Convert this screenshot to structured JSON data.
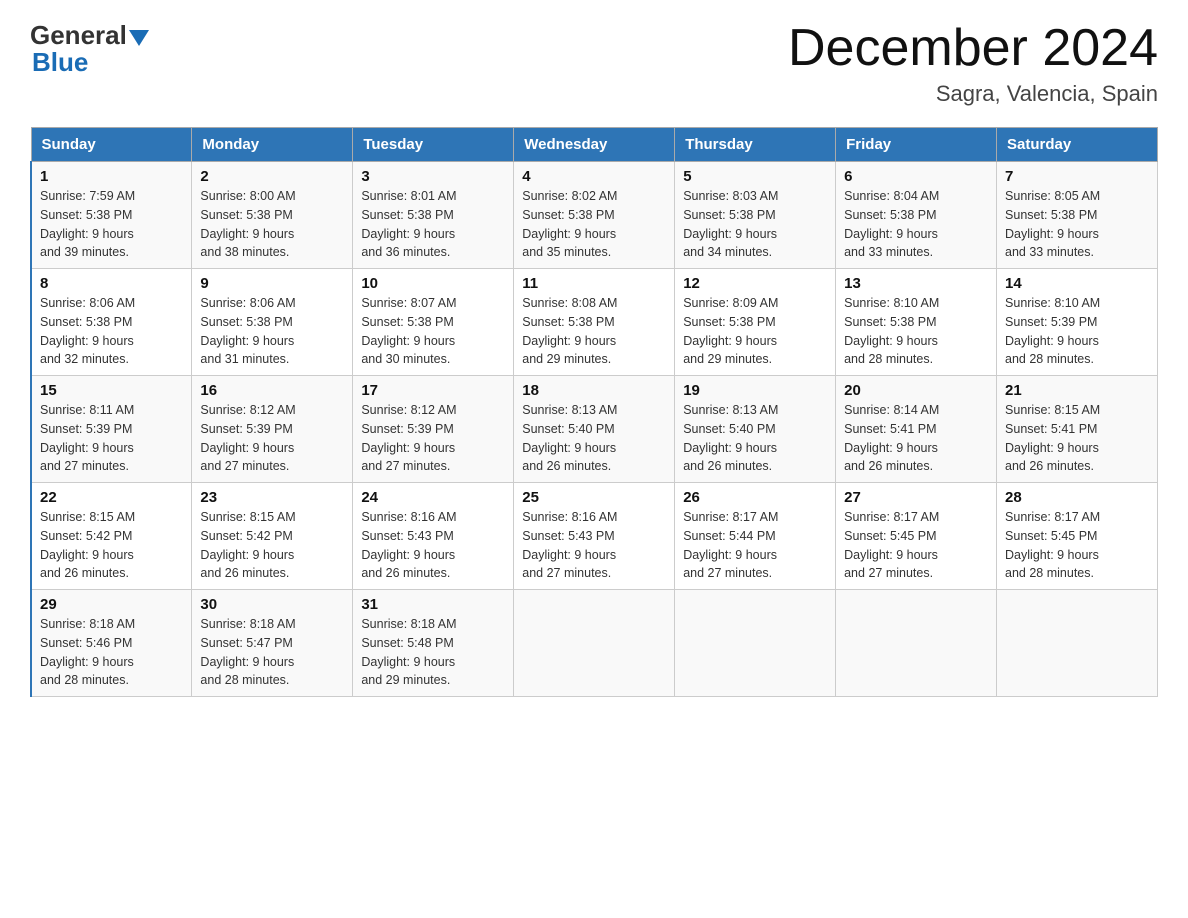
{
  "header": {
    "logo_general": "General",
    "logo_blue": "Blue",
    "title": "December 2024",
    "subtitle": "Sagra, Valencia, Spain"
  },
  "days_of_week": [
    "Sunday",
    "Monday",
    "Tuesday",
    "Wednesday",
    "Thursday",
    "Friday",
    "Saturday"
  ],
  "weeks": [
    [
      {
        "day": "1",
        "sunrise": "7:59 AM",
        "sunset": "5:38 PM",
        "daylight": "9 hours and 39 minutes."
      },
      {
        "day": "2",
        "sunrise": "8:00 AM",
        "sunset": "5:38 PM",
        "daylight": "9 hours and 38 minutes."
      },
      {
        "day": "3",
        "sunrise": "8:01 AM",
        "sunset": "5:38 PM",
        "daylight": "9 hours and 36 minutes."
      },
      {
        "day": "4",
        "sunrise": "8:02 AM",
        "sunset": "5:38 PM",
        "daylight": "9 hours and 35 minutes."
      },
      {
        "day": "5",
        "sunrise": "8:03 AM",
        "sunset": "5:38 PM",
        "daylight": "9 hours and 34 minutes."
      },
      {
        "day": "6",
        "sunrise": "8:04 AM",
        "sunset": "5:38 PM",
        "daylight": "9 hours and 33 minutes."
      },
      {
        "day": "7",
        "sunrise": "8:05 AM",
        "sunset": "5:38 PM",
        "daylight": "9 hours and 33 minutes."
      }
    ],
    [
      {
        "day": "8",
        "sunrise": "8:06 AM",
        "sunset": "5:38 PM",
        "daylight": "9 hours and 32 minutes."
      },
      {
        "day": "9",
        "sunrise": "8:06 AM",
        "sunset": "5:38 PM",
        "daylight": "9 hours and 31 minutes."
      },
      {
        "day": "10",
        "sunrise": "8:07 AM",
        "sunset": "5:38 PM",
        "daylight": "9 hours and 30 minutes."
      },
      {
        "day": "11",
        "sunrise": "8:08 AM",
        "sunset": "5:38 PM",
        "daylight": "9 hours and 29 minutes."
      },
      {
        "day": "12",
        "sunrise": "8:09 AM",
        "sunset": "5:38 PM",
        "daylight": "9 hours and 29 minutes."
      },
      {
        "day": "13",
        "sunrise": "8:10 AM",
        "sunset": "5:38 PM",
        "daylight": "9 hours and 28 minutes."
      },
      {
        "day": "14",
        "sunrise": "8:10 AM",
        "sunset": "5:39 PM",
        "daylight": "9 hours and 28 minutes."
      }
    ],
    [
      {
        "day": "15",
        "sunrise": "8:11 AM",
        "sunset": "5:39 PM",
        "daylight": "9 hours and 27 minutes."
      },
      {
        "day": "16",
        "sunrise": "8:12 AM",
        "sunset": "5:39 PM",
        "daylight": "9 hours and 27 minutes."
      },
      {
        "day": "17",
        "sunrise": "8:12 AM",
        "sunset": "5:39 PM",
        "daylight": "9 hours and 27 minutes."
      },
      {
        "day": "18",
        "sunrise": "8:13 AM",
        "sunset": "5:40 PM",
        "daylight": "9 hours and 26 minutes."
      },
      {
        "day": "19",
        "sunrise": "8:13 AM",
        "sunset": "5:40 PM",
        "daylight": "9 hours and 26 minutes."
      },
      {
        "day": "20",
        "sunrise": "8:14 AM",
        "sunset": "5:41 PM",
        "daylight": "9 hours and 26 minutes."
      },
      {
        "day": "21",
        "sunrise": "8:15 AM",
        "sunset": "5:41 PM",
        "daylight": "9 hours and 26 minutes."
      }
    ],
    [
      {
        "day": "22",
        "sunrise": "8:15 AM",
        "sunset": "5:42 PM",
        "daylight": "9 hours and 26 minutes."
      },
      {
        "day": "23",
        "sunrise": "8:15 AM",
        "sunset": "5:42 PM",
        "daylight": "9 hours and 26 minutes."
      },
      {
        "day": "24",
        "sunrise": "8:16 AM",
        "sunset": "5:43 PM",
        "daylight": "9 hours and 26 minutes."
      },
      {
        "day": "25",
        "sunrise": "8:16 AM",
        "sunset": "5:43 PM",
        "daylight": "9 hours and 27 minutes."
      },
      {
        "day": "26",
        "sunrise": "8:17 AM",
        "sunset": "5:44 PM",
        "daylight": "9 hours and 27 minutes."
      },
      {
        "day": "27",
        "sunrise": "8:17 AM",
        "sunset": "5:45 PM",
        "daylight": "9 hours and 27 minutes."
      },
      {
        "day": "28",
        "sunrise": "8:17 AM",
        "sunset": "5:45 PM",
        "daylight": "9 hours and 28 minutes."
      }
    ],
    [
      {
        "day": "29",
        "sunrise": "8:18 AM",
        "sunset": "5:46 PM",
        "daylight": "9 hours and 28 minutes."
      },
      {
        "day": "30",
        "sunrise": "8:18 AM",
        "sunset": "5:47 PM",
        "daylight": "9 hours and 28 minutes."
      },
      {
        "day": "31",
        "sunrise": "8:18 AM",
        "sunset": "5:48 PM",
        "daylight": "9 hours and 29 minutes."
      },
      null,
      null,
      null,
      null
    ]
  ],
  "labels": {
    "sunrise": "Sunrise:",
    "sunset": "Sunset:",
    "daylight": "Daylight:"
  },
  "colors": {
    "header_bg": "#2e75b6",
    "accent": "#1a6cb5"
  }
}
